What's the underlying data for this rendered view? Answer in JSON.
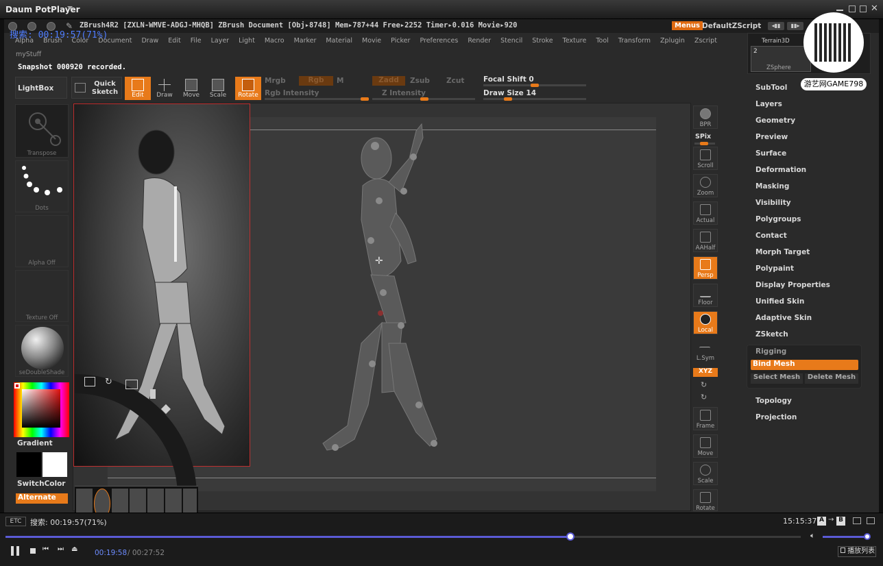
{
  "player": {
    "app_title": "Daum PotPlayer",
    "search_overlay": "搜索: 00:19:57(71%)",
    "status_text": "搜索: 00:19:57(71%)",
    "etc_label": "ETC",
    "clock": "15:15:37",
    "ab_a": "A",
    "ab_b": "B",
    "time_current": "00:19:58",
    "time_total": "/ 00:27:52",
    "playlist_label": "播放列表",
    "progress_percent": 71,
    "volume_percent": 100
  },
  "watermark": {
    "text": "游艺网GAME798"
  },
  "zbrush": {
    "info": "ZBrush4R2 [ZXLN-WMVE-ADGJ-MHQB]   ZBrush Document   [Obj▸8748] Mem▸787+44 Free▸2252 Timer▸0.016 Movie▸920",
    "menus_button": "Menus",
    "script_label": "DefaultZScript",
    "menubar": [
      "Alpha",
      "Brush",
      "Color",
      "Document",
      "Draw",
      "Edit",
      "File",
      "Layer",
      "Light",
      "Macro",
      "Marker",
      "Material",
      "Movie",
      "Picker",
      "Preferences",
      "Render",
      "Stencil",
      "Stroke",
      "Texture",
      "Tool",
      "Transform",
      "Zplugin",
      "Zscript"
    ],
    "mystuff": "myStuff",
    "snapshot_message": "Snapshot 000920 recorded.",
    "lightbox": "LightBox",
    "quick_sketch": "Quick Sketch",
    "tools": {
      "edit": "Edit",
      "draw": "Draw",
      "move": "Move",
      "scale": "Scale",
      "rotate": "Rotate"
    },
    "params": {
      "mrgb": "Mrgb",
      "rgb": "Rgb",
      "m": "M",
      "rgb_intensity": "Rgb Intensity",
      "zadd": "Zadd",
      "zsub": "Zsub",
      "zcut": "Zcut",
      "z_intensity": "Z Intensity",
      "focal_shift": "Focal Shift 0",
      "draw_size": "Draw Size 14"
    },
    "shelf": {
      "transpose": "Transpose",
      "dots": "Dots",
      "alpha": "Alpha Off",
      "texture": "Texture Off",
      "material": "seDoubleShade",
      "gradient": "Gradient",
      "switch_color": "SwitchColor",
      "alternate": "Alternate"
    },
    "right_tools": {
      "bpr": "BPR",
      "spix": "SPix",
      "scroll": "Scroll",
      "zoom": "Zoom",
      "actual": "Actual",
      "aahalf": "AAHalf",
      "persp": "Persp",
      "floor": "Floor",
      "local": "Local",
      "lsym": "L.Sym",
      "xyz": "XYZ",
      "frame": "Frame",
      "move": "Move",
      "scale": "Scale",
      "rotate": "Rotate"
    },
    "tool_thumbs": {
      "terrain": "Terrain3D",
      "zsphere": "ZSphere",
      "count": "2"
    },
    "palette": [
      "SubTool",
      "Layers",
      "Geometry",
      "Preview",
      "Surface",
      "Deformation",
      "Masking",
      "Visibility",
      "Polygroups",
      "Contact",
      "Morph Target",
      "Polypaint",
      "Display Properties",
      "Unified Skin",
      "Adaptive Skin",
      "ZSketch"
    ],
    "rigging": {
      "title": "Rigging",
      "bind_mesh": "Bind Mesh",
      "select_mesh": "Select Mesh",
      "delete_mesh": "Delete Mesh"
    },
    "palette_after": [
      "Topology",
      "Projection"
    ]
  },
  "colors": {
    "accent": "#e87a1a",
    "seek": "#5b5bd6",
    "search_text": "#4f7dff"
  }
}
